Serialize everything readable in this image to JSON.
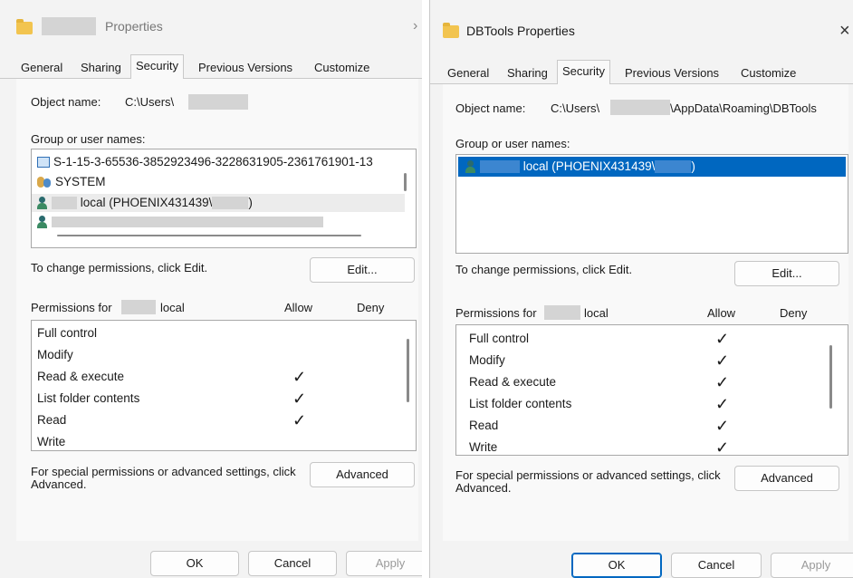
{
  "left": {
    "title": "Properties",
    "tabs": [
      "General",
      "Sharing",
      "Security",
      "Previous Versions",
      "Customize"
    ],
    "object_name_label": "Object name:",
    "object_name_value": "C:\\Users\\",
    "group_label": "Group or user names:",
    "users": [
      "S-1-15-3-65536-3852923496-3228631905-2361761901-13",
      "SYSTEM",
      "local (PHOENIX431439\\",
      ")"
    ],
    "change_text": "To change permissions, click Edit.",
    "edit_button": "Edit...",
    "permissions_for": "Permissions for",
    "permissions_user": "local",
    "allow_header": "Allow",
    "deny_header": "Deny",
    "permissions": [
      "Full control",
      "Modify",
      "Read & execute",
      "List folder contents",
      "Read",
      "Write"
    ],
    "allow_checks": [
      false,
      false,
      true,
      true,
      true,
      false
    ],
    "special_text": "For special permissions or advanced settings, click Advanced.",
    "advanced_button": "Advanced",
    "ok_button": "OK",
    "cancel_button": "Cancel",
    "apply_button": "Apply"
  },
  "right": {
    "title": "DBTools Properties",
    "close_label": "×",
    "tabs": [
      "General",
      "Sharing",
      "Security",
      "Previous Versions",
      "Customize"
    ],
    "object_name_label": "Object name:",
    "object_name_prefix": "C:\\Users\\",
    "object_name_suffix": "\\AppData\\Roaming\\DBTools",
    "group_label": "Group or user names:",
    "selected_user_a": "local (PHOENIX431439\\",
    "selected_user_b": ")",
    "change_text": "To change permissions, click Edit.",
    "edit_button": "Edit...",
    "permissions_for": "Permissions for",
    "permissions_user": "local",
    "allow_header": "Allow",
    "deny_header": "Deny",
    "permissions": [
      "Full control",
      "Modify",
      "Read & execute",
      "List folder contents",
      "Read",
      "Write"
    ],
    "allow_checks": [
      true,
      true,
      true,
      true,
      true,
      true
    ],
    "special_text": "For special permissions or advanced settings, click Advanced.",
    "advanced_button": "Advanced",
    "ok_button": "OK",
    "cancel_button": "Cancel",
    "apply_button": "Apply"
  },
  "colors": {
    "selection": "#0067c0",
    "folder": "#f2c44f"
  },
  "check_glyph": "✓"
}
